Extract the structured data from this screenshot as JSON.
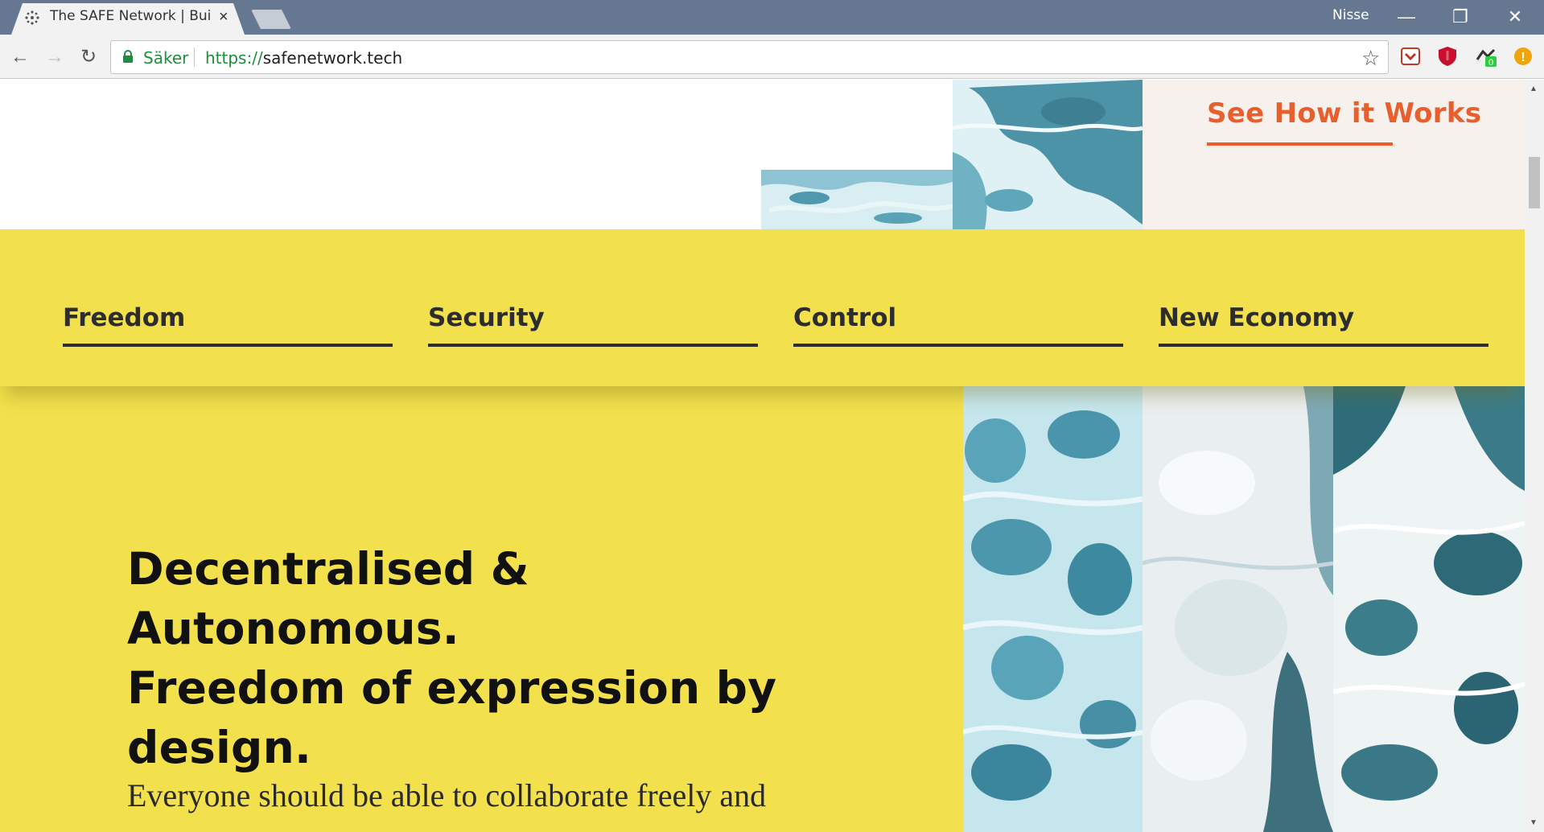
{
  "browser": {
    "tab_title": "The SAFE Network | Build",
    "tab_close": "×",
    "profile_name": "Nisse",
    "window_controls": {
      "minimize": "—",
      "restore": "❐",
      "close": "✕"
    },
    "nav": {
      "back": "←",
      "forward": "→",
      "reload": "↻"
    },
    "security_label": "Säker",
    "url_scheme": "https://",
    "url_host": "safenetwork.tech",
    "bookmark_star": "☆",
    "extensions": [
      "pocket-icon",
      "ublock-shield-icon",
      "tampermonkey-icon",
      "alert-extension-icon"
    ],
    "extension_badge": "0",
    "extension_alert": "!"
  },
  "page": {
    "cta": {
      "label": "See How it Works"
    },
    "features": [
      "Freedom",
      "Security",
      "Control",
      "New Economy"
    ],
    "hero": {
      "title_lines": [
        "Decentralised & Autonomous.",
        "Freedom of expression by",
        "design."
      ],
      "body": "Everyone should be able to collaborate freely and"
    }
  },
  "colors": {
    "chrome_titlebar": "#667891",
    "yellow": "#f2e04c",
    "accent_orange": "#e85e2d",
    "cta_panel_bg": "#f6f1ec",
    "text_dark": "#2d2d2d",
    "secure_green": "#1e8e3e"
  }
}
